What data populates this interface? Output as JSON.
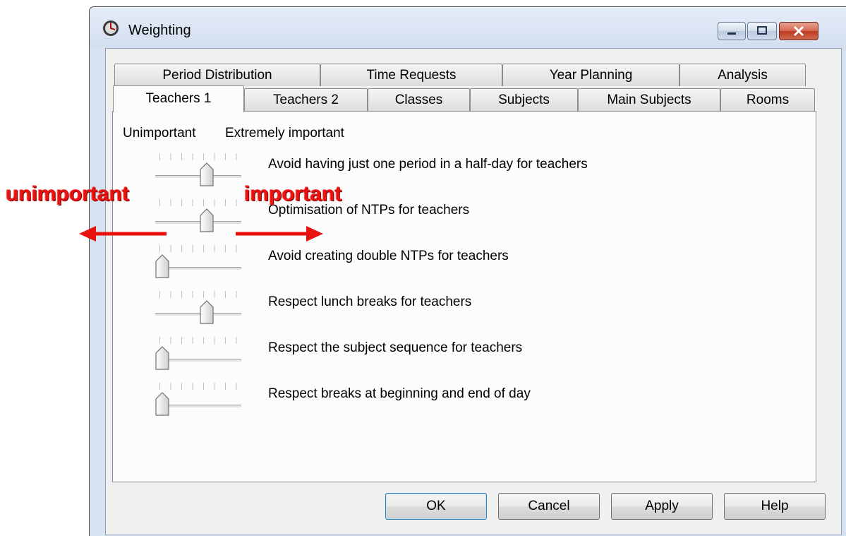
{
  "window": {
    "title": "Weighting"
  },
  "tabs_row1": [
    "Period Distribution",
    "Time Requests",
    "Year Planning",
    "Analysis"
  ],
  "tabs_row2": [
    "Teachers 1",
    "Teachers 2",
    "Classes",
    "Subjects",
    "Main Subjects",
    "Rooms"
  ],
  "active_tab": "Teachers 1",
  "scale": {
    "low_label": "Unimportant",
    "high_label": "Extremely important"
  },
  "criteria": [
    {
      "label": "Avoid having just one period in a half-day for teachers",
      "level": 0.57
    },
    {
      "label": "Optimisation of NTPs for teachers",
      "level": 0.57
    },
    {
      "label": "Avoid creating double NTPs for teachers",
      "level": 0.0
    },
    {
      "label": "Respect lunch breaks for teachers",
      "level": 0.57
    },
    {
      "label": "Respect the subject sequence for teachers",
      "level": 0.0
    },
    {
      "label": "Respect breaks at beginning and end of day",
      "level": 0.0
    }
  ],
  "annotations": {
    "left": "unimportant",
    "right": "important",
    "color": "#e8120f"
  },
  "buttons": {
    "ok": "OK",
    "cancel": "Cancel",
    "apply": "Apply",
    "help": "Help"
  }
}
